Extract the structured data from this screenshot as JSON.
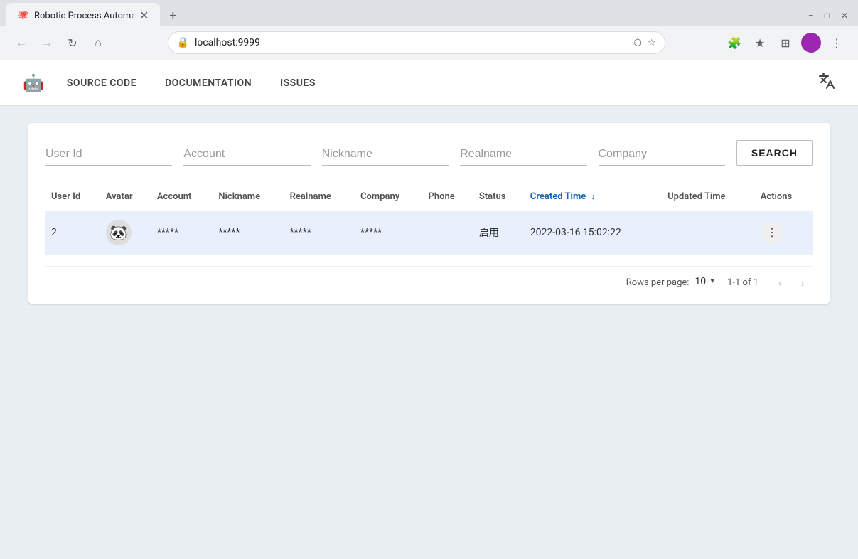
{
  "browser": {
    "tab_title": "Robotic Process Automation T",
    "tab_favicon": "🐙",
    "url": "localhost:9999",
    "lock_icon": "🔒"
  },
  "header": {
    "logo_icon": "🤖",
    "nav_items": [
      {
        "id": "source-code",
        "label": "SOURCE CODE"
      },
      {
        "id": "documentation",
        "label": "DOCUMENTATION"
      },
      {
        "id": "issues",
        "label": "ISSUES"
      }
    ],
    "translate_icon": "A"
  },
  "search": {
    "fields": [
      {
        "id": "user-id",
        "placeholder": "User Id",
        "value": ""
      },
      {
        "id": "account",
        "placeholder": "Account",
        "value": ""
      },
      {
        "id": "nickname",
        "placeholder": "Nickname",
        "value": ""
      },
      {
        "id": "realname",
        "placeholder": "Realname",
        "value": ""
      },
      {
        "id": "company",
        "placeholder": "Company",
        "value": ""
      }
    ],
    "search_button_label": "SEARCH"
  },
  "table": {
    "columns": [
      {
        "id": "user-id",
        "label": "User Id",
        "sortable": false
      },
      {
        "id": "avatar",
        "label": "Avatar",
        "sortable": false
      },
      {
        "id": "account",
        "label": "Account",
        "sortable": false
      },
      {
        "id": "nickname",
        "label": "Nickname",
        "sortable": false
      },
      {
        "id": "realname",
        "label": "Realname",
        "sortable": false
      },
      {
        "id": "company",
        "label": "Company",
        "sortable": false
      },
      {
        "id": "phone",
        "label": "Phone",
        "sortable": false
      },
      {
        "id": "status",
        "label": "Status",
        "sortable": false
      },
      {
        "id": "created-time",
        "label": "Created Time",
        "sortable": true,
        "sort_arrow": "↓"
      },
      {
        "id": "updated-time",
        "label": "Updated Time",
        "sortable": false
      },
      {
        "id": "actions",
        "label": "Actions",
        "sortable": false
      }
    ],
    "rows": [
      {
        "user_id": "2",
        "avatar_icon": "🐼",
        "account": "*****",
        "nickname": "*****",
        "realname": "*****",
        "company": "*****",
        "phone": "",
        "status": "启用",
        "created_time": "2022-03-16 15:02:22",
        "updated_time": ""
      }
    ]
  },
  "pagination": {
    "rows_per_page_label": "Rows per page:",
    "rows_per_page_value": "10",
    "page_info": "1-1 of 1"
  }
}
